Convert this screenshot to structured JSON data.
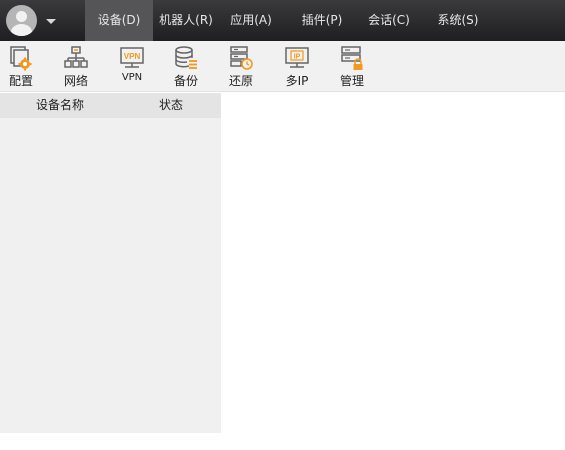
{
  "menubar": {
    "items": [
      {
        "label": "设备(D)"
      },
      {
        "label": "机器人(R)"
      },
      {
        "label": "应用(A)"
      },
      {
        "label": "插件(P)"
      },
      {
        "label": "会话(C)"
      },
      {
        "label": "系统(S)"
      }
    ],
    "active": "设备(D)"
  },
  "toolbar": {
    "items": [
      {
        "label": "配置",
        "icon": "config-icon"
      },
      {
        "label": "网络",
        "icon": "network-icon"
      },
      {
        "label": "VPN",
        "icon": "vpn-icon",
        "icon_text": "VPN"
      },
      {
        "label": "备份",
        "icon": "backup-icon"
      },
      {
        "label": "还原",
        "icon": "restore-icon"
      },
      {
        "label": "多IP",
        "icon": "multi-ip-icon",
        "icon_text": "IP"
      },
      {
        "label": "管理",
        "icon": "manage-icon"
      }
    ],
    "accent": "#f39a1e"
  },
  "device_list": {
    "columns": [
      "设备名称",
      "状态"
    ],
    "rows": []
  }
}
